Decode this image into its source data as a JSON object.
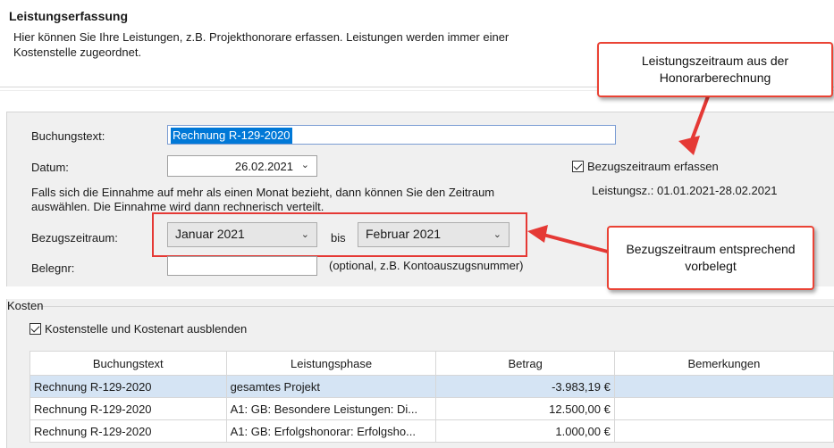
{
  "header": {
    "title": "Leistungserfassung",
    "description": "Hier können Sie Ihre Leistungen, z.B. Projekthonorare erfassen. Leistungen werden immer einer Kostenstelle zugeordnet."
  },
  "form": {
    "buchungstext_label": "Buchungstext:",
    "buchungstext_value": "Rechnung R-129-2020",
    "datum_label": "Datum:",
    "datum_value": "26.02.2021",
    "hint_text": "Falls sich die Einnahme auf mehr als einen Monat bezieht, dann können Sie den Zeitraum auswählen. Die Einnahme wird dann rechnerisch verteilt.",
    "bezugszeitraum_label": "Bezugszeitraum:",
    "bezug_from": "Januar 2021",
    "bis_label": "bis",
    "bezug_to": "Februar 2021",
    "belegnr_label": "Belegnr:",
    "belegnr_value": "",
    "belegnr_hint": "(optional, z.B. Kontoauszugsnummer)",
    "bezug_checkbox_label": "Bezugszeitraum erfassen",
    "bezug_checked": true,
    "leistungszeitraum_text": "Leistungsz.: 01.01.2021-28.02.2021"
  },
  "kosten": {
    "group_label": "Kosten",
    "checkbox_label": "Kostenstelle und Kostenart ausblenden",
    "checked": true,
    "columns": [
      "Buchungstext",
      "Leistungsphase",
      "Betrag",
      "Bemerkungen"
    ],
    "rows": [
      [
        "Rechnung R-129-2020",
        "gesamtes Projekt",
        "-3.983,19 €",
        ""
      ],
      [
        "Rechnung R-129-2020",
        "A1: GB: Besondere Leistungen: Di...",
        "12.500,00 €",
        ""
      ],
      [
        "Rechnung R-129-2020",
        "A1: GB: Erfolgshonorar: Erfolgsho...",
        "1.000,00 €",
        ""
      ]
    ]
  },
  "callouts": {
    "top": "Leistungszeitraum aus der Honorarberechnung",
    "middle": "Bezugszeitraum entsprechend vorbelegt"
  },
  "colors": {
    "callout_border": "#ea4335",
    "selection_blue": "#0078d7",
    "row_highlight": "#d5e4f4"
  }
}
